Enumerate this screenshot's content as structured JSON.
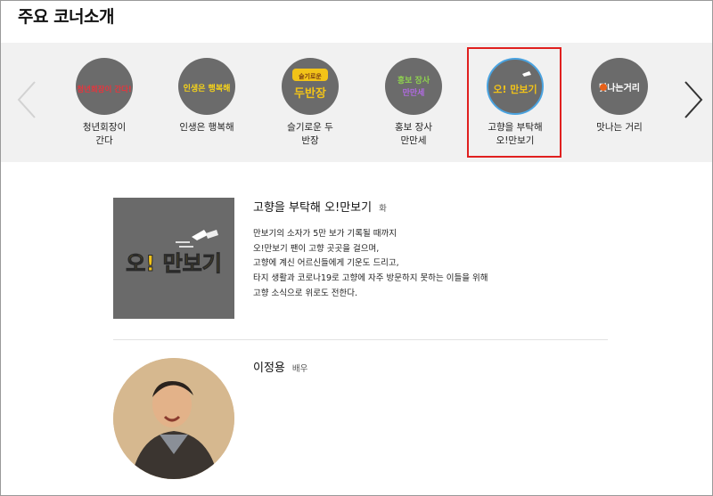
{
  "section": {
    "title": "주요 코너소개"
  },
  "carousel": {
    "items": [
      {
        "label_line1": "청년회장이",
        "label_line2": "간다",
        "logo_text": "청년회장이 간다!"
      },
      {
        "label_line1": "인생은 행복해",
        "label_line2": "",
        "logo_text": "인생은 행복해"
      },
      {
        "label_line1": "슬기로운 두",
        "label_line2": "반장",
        "logo_text_top": "슬기로운",
        "logo_text_main": "두반장"
      },
      {
        "label_line1": "홍보 장사",
        "label_line2": "만만세",
        "logo_text_top": "홍보 장사",
        "logo_text_main": "만만세"
      },
      {
        "label_line1": "고향을 부탁해",
        "label_line2": "오!만보기",
        "logo_text": "오! 만보기"
      },
      {
        "label_line1": "맛나는 거리",
        "label_line2": "",
        "logo_text": "맛나는거리"
      }
    ],
    "selected_index": 4
  },
  "program": {
    "title": "고향을 부탁해 오!만보기",
    "day": "화",
    "thumb_text": "오! 만보기",
    "description": [
      "만보기의 소자가 5만 보가 기록될 때까지",
      "오!만보기 팬이 고향 곳곳을 걸으며,",
      "고향에 계신 어르신들에게 기운도 드리고,",
      "타지 생활과 코로나19로 고향에 자주 방문하지 못하는 이들을 위해",
      "고향 소식으로 위로도 전한다."
    ]
  },
  "cast": {
    "name": "이정용",
    "role": "배우"
  },
  "colors": {
    "carousel_bg": "#f1f1f1",
    "circle_bg": "#6b6b6b",
    "highlight": "#e0201f",
    "logo_yellow": "#f2c318"
  }
}
